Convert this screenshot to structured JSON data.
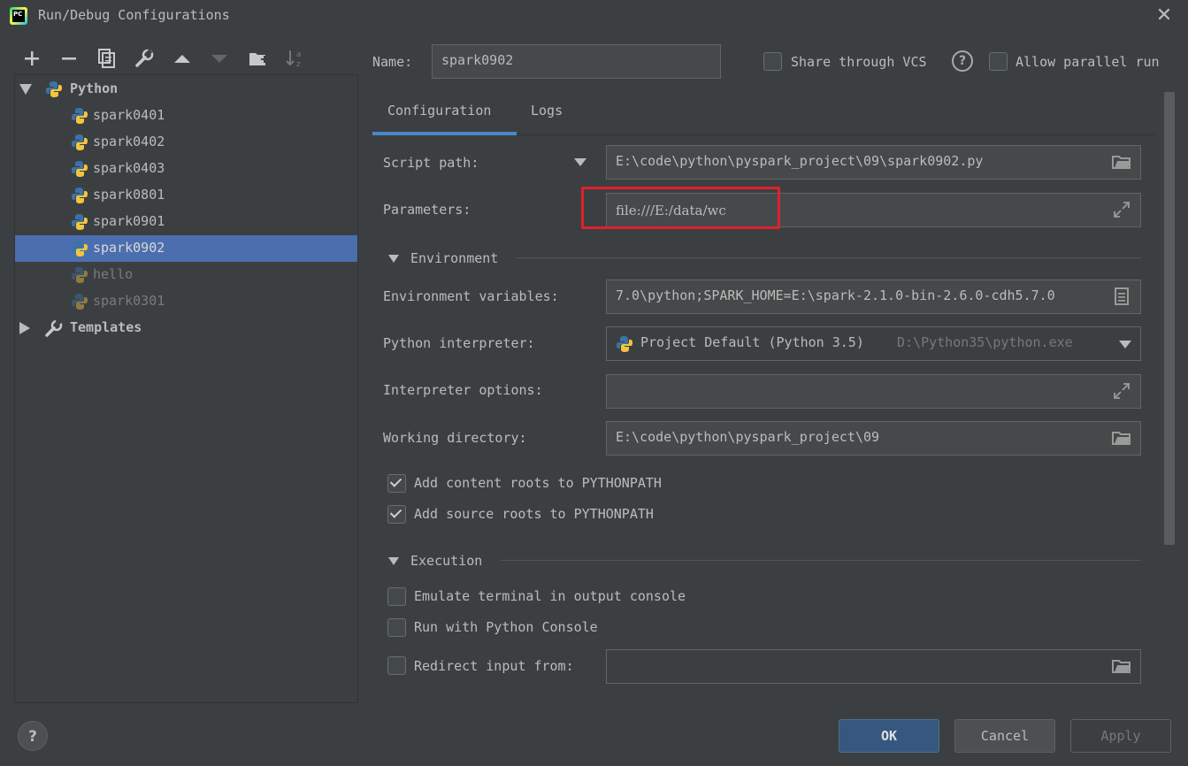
{
  "window": {
    "title": "Run/Debug Configurations"
  },
  "tree": {
    "root": "Python",
    "items": [
      "spark0401",
      "spark0402",
      "spark0403",
      "spark0801",
      "spark0901",
      "spark0902",
      "hello",
      "spark0301"
    ],
    "selected": "spark0902",
    "templates": "Templates"
  },
  "header": {
    "name_label": "Name:",
    "name_value": "spark0902",
    "share_vcs": "Share through VCS",
    "allow_parallel": "Allow parallel run"
  },
  "tabs": [
    "Configuration",
    "Logs"
  ],
  "config": {
    "script_path_label": "Script path:",
    "script_path_value": "E:\\code\\python\\pyspark_project\\09\\spark0902.py",
    "parameters_label": "Parameters:",
    "parameters_value": "file:///E:/data/wc",
    "environment_section": "Environment",
    "env_vars_label": "Environment variables:",
    "env_vars_value": "7.0\\python;SPARK_HOME=E:\\spark-2.1.0-bin-2.6.0-cdh5.7.0",
    "interpreter_label": "Python interpreter:",
    "interpreter_value": "Project Default (Python 3.5)",
    "interpreter_path": "D:\\Python35\\python.exe",
    "interp_options_label": "Interpreter options:",
    "interp_options_value": "",
    "working_dir_label": "Working directory:",
    "working_dir_value": "E:\\code\\python\\pyspark_project\\09",
    "add_content_roots": "Add content roots to PYTHONPATH",
    "add_source_roots": "Add source roots to PYTHONPATH",
    "execution_section": "Execution",
    "emulate_terminal": "Emulate terminal in output console",
    "run_with_console": "Run with Python Console",
    "redirect_input": "Redirect input from:",
    "redirect_input_value": ""
  },
  "buttons": {
    "ok": "OK",
    "cancel": "Cancel",
    "apply": "Apply",
    "help": "?"
  },
  "colors": {
    "accent": "#4a88c7",
    "selection": "#4b6eaf",
    "highlight_box": "#e0202a",
    "background": "#3c3f41"
  }
}
